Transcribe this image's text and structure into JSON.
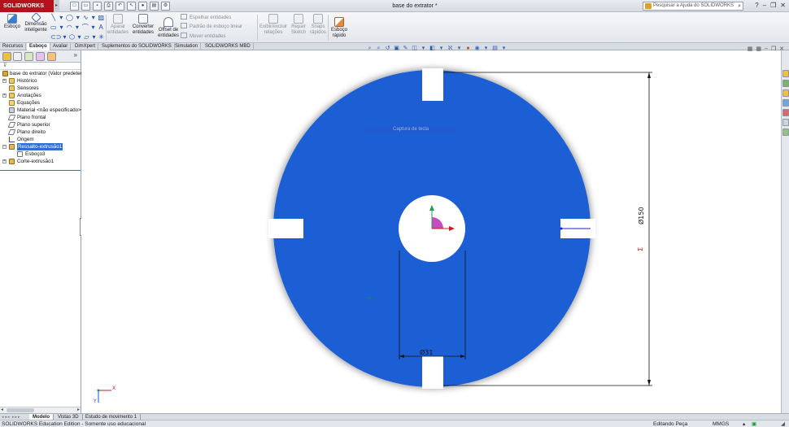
{
  "app": {
    "brand": "SOLIDWORKS",
    "document_title": "base do extrator *",
    "help_search_placeholder": "Pesquisar a Ajuda do SOLIDWORKS"
  },
  "command_manager": {
    "sketch": "Esboço",
    "smart_dim_1": "Dimensão",
    "smart_dim_2": "inteligente",
    "trim_1": "Aparar",
    "trim_2": "entidades",
    "convert_1": "Converter",
    "convert_2": "entidades",
    "offset_1": "Offset de",
    "offset_2": "entidades",
    "mirror": "Espelhar entidades",
    "linear_pattern": "Padrão de esboço linear",
    "move": "Mover entidades",
    "relations_1": "Exibir/excluir",
    "relations_2": "relações",
    "repair_1": "Repair",
    "repair_2": "Sketch",
    "snaps_1": "Snaps",
    "snaps_2": "rápidos",
    "rapid_1": "Esboço",
    "rapid_2": "rápido"
  },
  "tabs": [
    "Recursos",
    "Esboço",
    "Avaliar",
    "DimXpert",
    "Suplementos do SOLIDWORKS",
    "Simulation",
    "SOLIDWORKS MBD"
  ],
  "active_tab": "Esboço",
  "feature_tree": {
    "root": "base do extrator  (Valor predeterm",
    "items": [
      {
        "label": "Histórico",
        "expandable": true
      },
      {
        "label": "Sensores",
        "expandable": false
      },
      {
        "label": "Anotações",
        "expandable": true
      },
      {
        "label": "Equações",
        "expandable": false
      },
      {
        "label": "Material <não especificado>",
        "expandable": false
      },
      {
        "label": "Plano frontal",
        "expandable": false
      },
      {
        "label": "Plano superior",
        "expandable": false
      },
      {
        "label": "Plano direito",
        "expandable": false
      },
      {
        "label": "Origem",
        "expandable": false
      },
      {
        "label": "Ressalto-extrusão1",
        "expandable": true,
        "selected": true
      },
      {
        "label": "Esboço3",
        "expandable": false,
        "child": true
      },
      {
        "label": "Corte-extrusão1",
        "expandable": true
      }
    ]
  },
  "graphics": {
    "ghost_tooltip": "Captura de tecla",
    "dim_outer": "Ø150",
    "dim_inner": "Ø31",
    "axis_x": "X",
    "axis_y": "Y",
    "part_color": "#1f5fd4"
  },
  "bottom_tabs": [
    "Modelo",
    "Vistas 3D",
    "Estudo de movimento 1"
  ],
  "active_bottom_tab": "Modelo",
  "status": {
    "left": "SOLIDWORKS Education Edition - Somente uso educacional",
    "mode": "Editando Peça",
    "units": "MMGS"
  }
}
